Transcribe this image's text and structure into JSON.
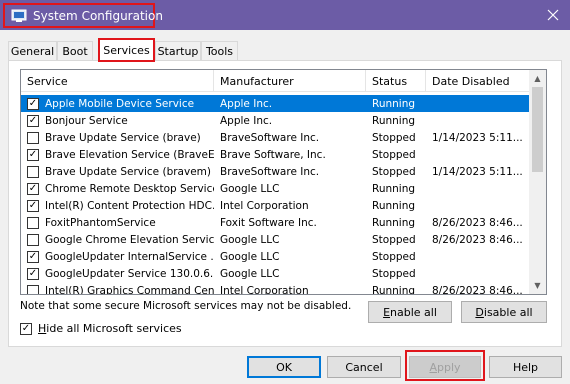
{
  "window": {
    "title": "System Configuration",
    "close_glyph": "✕"
  },
  "tabs": [
    {
      "label": "General"
    },
    {
      "label": "Boot"
    },
    {
      "label": "Services"
    },
    {
      "label": "Startup"
    },
    {
      "label": "Tools"
    }
  ],
  "active_tab": "Services",
  "table": {
    "columns": [
      "Service",
      "Manufacturer",
      "Status",
      "Date Disabled"
    ],
    "rows": [
      {
        "checked": true,
        "service": "Apple Mobile Device Service",
        "manufacturer": "Apple Inc.",
        "status": "Running",
        "date": ""
      },
      {
        "checked": true,
        "service": "Bonjour Service",
        "manufacturer": "Apple Inc.",
        "status": "Running",
        "date": ""
      },
      {
        "checked": false,
        "service": "Brave Update Service (brave)",
        "manufacturer": "BraveSoftware Inc.",
        "status": "Stopped",
        "date": "1/14/2023 5:11..."
      },
      {
        "checked": true,
        "service": "Brave Elevation Service (BraveEl...",
        "manufacturer": "Brave Software, Inc.",
        "status": "Stopped",
        "date": ""
      },
      {
        "checked": false,
        "service": "Brave Update Service (bravem)",
        "manufacturer": "BraveSoftware Inc.",
        "status": "Stopped",
        "date": "1/14/2023 5:11..."
      },
      {
        "checked": true,
        "service": "Chrome Remote Desktop Service",
        "manufacturer": "Google LLC",
        "status": "Running",
        "date": ""
      },
      {
        "checked": true,
        "service": "Intel(R) Content Protection HDC...",
        "manufacturer": "Intel Corporation",
        "status": "Running",
        "date": ""
      },
      {
        "checked": false,
        "service": "FoxitPhantomService",
        "manufacturer": "Foxit Software Inc.",
        "status": "Running",
        "date": "8/26/2023 8:46..."
      },
      {
        "checked": false,
        "service": "Google Chrome Elevation Servic...",
        "manufacturer": "Google LLC",
        "status": "Stopped",
        "date": "8/26/2023 8:46..."
      },
      {
        "checked": true,
        "service": "GoogleUpdater InternalService ...",
        "manufacturer": "Google LLC",
        "status": "Stopped",
        "date": ""
      },
      {
        "checked": true,
        "service": "GoogleUpdater Service 130.0.6...",
        "manufacturer": "Google LLC",
        "status": "Stopped",
        "date": ""
      },
      {
        "checked": false,
        "service": "Intel(R) Graphics Command Cen...",
        "manufacturer": "Intel Corporation",
        "status": "Running",
        "date": "8/26/2023 8:46..."
      }
    ],
    "selected_index": 0
  },
  "note": "Note that some secure Microsoft services may not be disabled.",
  "enable_all": {
    "mnemonic": "E",
    "rest": "nable all"
  },
  "disable_all": {
    "mnemonic": "D",
    "rest": "isable all"
  },
  "hide_ms": {
    "checked": true,
    "mnemonic": "H",
    "rest": "ide all Microsoft services"
  },
  "footer": {
    "ok": "OK",
    "cancel": "Cancel",
    "apply": {
      "mnemonic": "A",
      "rest": "pply"
    },
    "help": "Help"
  },
  "colors": {
    "titlebar": "#6c5ca6",
    "highlight": "#e0151b",
    "selection": "#0078d7"
  }
}
